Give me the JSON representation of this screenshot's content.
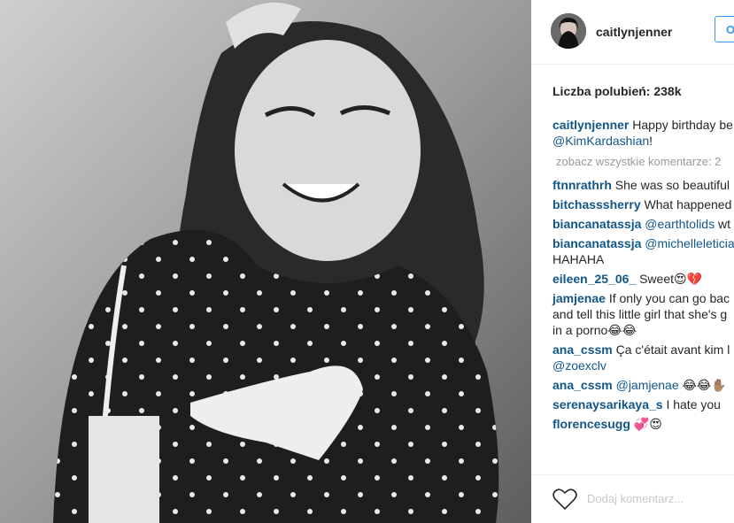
{
  "post": {
    "image_alt_icon": "photo",
    "username": "caitlynjenner",
    "follow_label": "O",
    "likes_text": "Liczba polubień: 238k",
    "caption_text_1": " Happy birthday be",
    "caption_mention": "@KimKardashian",
    "caption_text_2": "!",
    "view_all": "zobacz wszystkie komentarze: 2",
    "add_comment_placeholder": "Dodaj komentarz..."
  },
  "comments": [
    {
      "user": "ftnnrathrh",
      "text": " She was so beautiful"
    },
    {
      "user": "bitchasssherry",
      "text": " What happened"
    },
    {
      "user": "biancanatassja",
      "mention": " @earthtolids",
      "text": " wt"
    },
    {
      "user": "biancanatassja",
      "mention": " @michelleleticia",
      "text2": "HAHAHA"
    },
    {
      "user": "eileen_25_06_",
      "text": " Sweet😍💔"
    },
    {
      "user": "jamjenae",
      "text": " If only you can go bac",
      "text2": "and tell this little girl that she's g",
      "text3": "in a porno😂😂"
    },
    {
      "user": "ana_cssm",
      "text": " Ça c'était avant kim l",
      "mention2": "@zoexclv"
    },
    {
      "user": "ana_cssm",
      "mention": " @jamjenae",
      "text": " 😂😂✋🏽"
    },
    {
      "user": "serenaysarikaya_s",
      "text": " I hate you"
    },
    {
      "user": "florencesugg",
      "text": " 💞😍"
    }
  ]
}
